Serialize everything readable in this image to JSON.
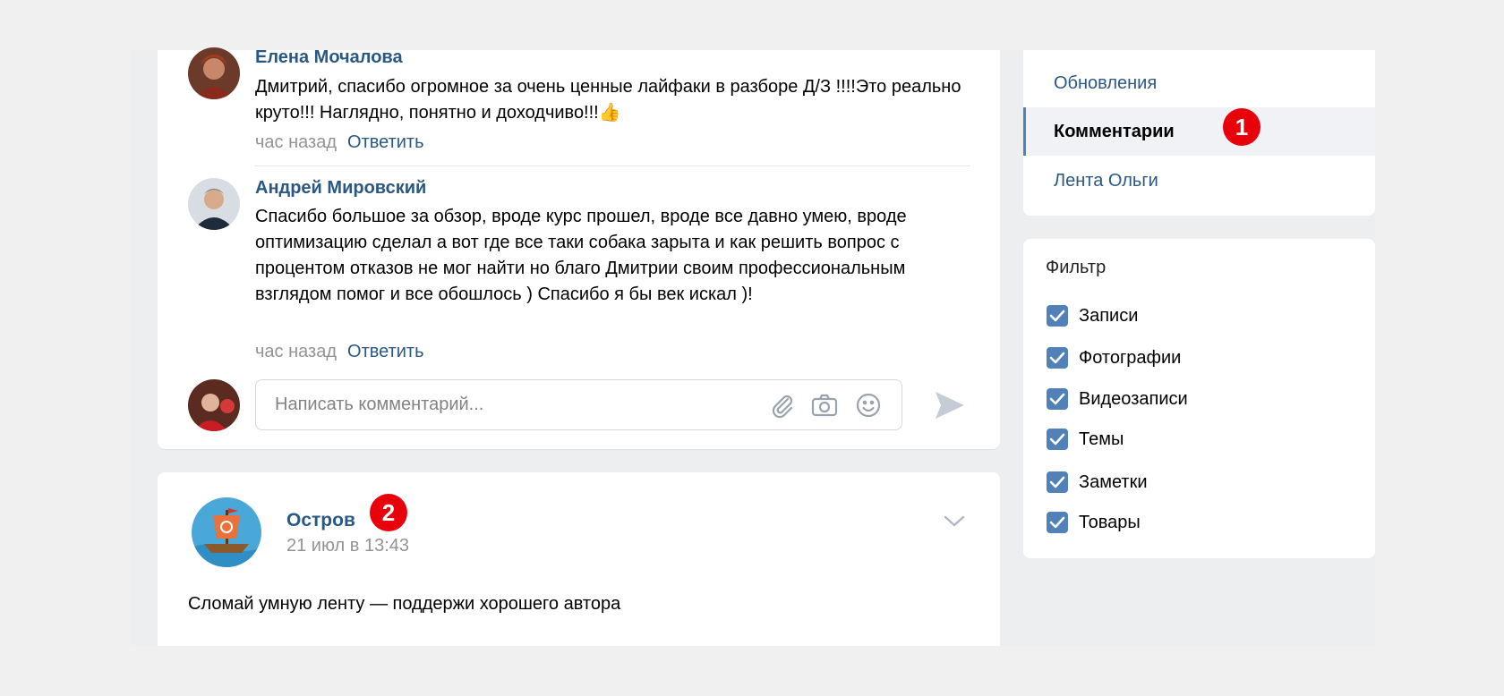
{
  "comments": [
    {
      "author": "Елена Мочалова",
      "text": "Дмитрий, спасибо огромное за очень ценные лайфаки в разборе Д/З !!!!Это реально круто!!! Наглядно, понятно и доходчиво!!!👍",
      "time": "час назад",
      "reply": "Ответить"
    },
    {
      "author": "Андрей Мировский",
      "text": "Спасибо большое за обзор, вроде курс прошел, вроде все давно умею, вроде оптимизацию сделал а вот где все таки собака зарыта и как решить вопрос с процентом отказов не мог найти но благо Дмитрии своим профессиональным взглядом помог и все обошлось ) Спасибо я бы век искал )!",
      "time": "час назад",
      "reply": "Ответить"
    }
  ],
  "comment_input": {
    "placeholder": "Написать комментарий..."
  },
  "post": {
    "author": "Остров",
    "date": "21 июл в 13:43",
    "text": "Сломай умную ленту — поддержи хорошего автора"
  },
  "nav": {
    "items": [
      {
        "label": "Обновления",
        "active": false
      },
      {
        "label": "Комментарии",
        "active": true
      },
      {
        "label": "Лента Ольги",
        "active": false
      }
    ]
  },
  "filter": {
    "title": "Фильтр",
    "options": [
      {
        "label": "Записи",
        "checked": true
      },
      {
        "label": "Фотографии",
        "checked": true
      },
      {
        "label": "Видеозаписи",
        "checked": true
      },
      {
        "label": "Темы",
        "checked": true
      },
      {
        "label": "Заметки",
        "checked": true
      },
      {
        "label": "Товары",
        "checked": true
      }
    ]
  },
  "badges": {
    "one": "1",
    "two": "2"
  },
  "colors": {
    "link": "#2a5885",
    "accent": "#5181b8",
    "badge": "#e8000a"
  }
}
